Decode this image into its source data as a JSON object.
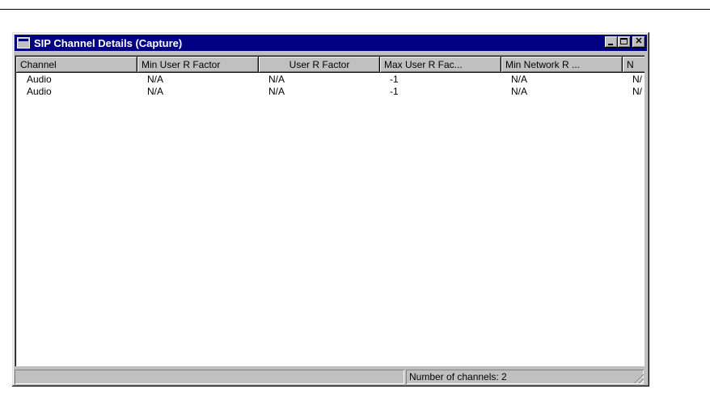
{
  "window": {
    "title": "SIP Channel Details (Capture)",
    "minimize_label": "_",
    "maximize_label": "□",
    "close_label": "✕"
  },
  "table": {
    "columns": [
      "Channel",
      "Min User R Factor",
      "User R Factor",
      "Max User R Fac...",
      "Min Network R ...",
      "N"
    ],
    "rows": [
      [
        "Audio",
        "N/A",
        "N/A",
        "-1",
        "N/A",
        "N/"
      ],
      [
        "Audio",
        "N/A",
        "N/A",
        "-1",
        "N/A",
        "N/"
      ]
    ]
  },
  "status": {
    "channel_count_text": "Number of channels: 2"
  },
  "icons": {
    "window_icon": "window-icon",
    "scroll_left": "arrow-left-icon",
    "scroll_right": "arrow-right-icon",
    "resize_grip": "resize-grip-icon"
  }
}
